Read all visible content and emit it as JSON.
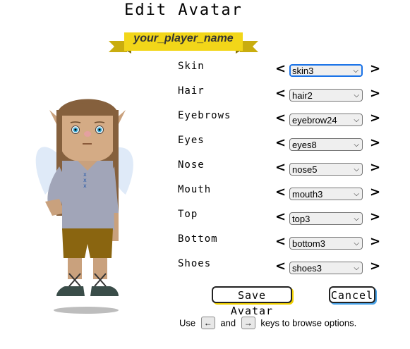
{
  "page": {
    "title": "Edit Avatar"
  },
  "banner": {
    "player_name": "your_player_name"
  },
  "colors": {
    "banner_yellow": "#f2d619",
    "save_accent": "#f0d000",
    "cancel_accent": "#4aa3e8",
    "focus_blue": "#1a73e8"
  },
  "options": [
    {
      "label": "Skin",
      "value": "skin3",
      "prev": "<",
      "next": ">"
    },
    {
      "label": "Hair",
      "value": "hair2",
      "prev": "<",
      "next": ">"
    },
    {
      "label": "Eyebrows",
      "value": "eyebrow24",
      "prev": "<",
      "next": ">"
    },
    {
      "label": "Eyes",
      "value": "eyes8",
      "prev": "<",
      "next": ">"
    },
    {
      "label": "Nose",
      "value": "nose5",
      "prev": "<",
      "next": ">"
    },
    {
      "label": "Mouth",
      "value": "mouth3",
      "prev": "<",
      "next": ">"
    },
    {
      "label": "Top",
      "value": "top3",
      "prev": "<",
      "next": ">"
    },
    {
      "label": "Bottom",
      "value": "bottom3",
      "prev": "<",
      "next": ">"
    },
    {
      "label": "Shoes",
      "value": "shoes3",
      "prev": "<",
      "next": ">"
    }
  ],
  "buttons": {
    "save": "Save Avatar",
    "cancel": "Cancel"
  },
  "hint": {
    "use": "Use",
    "and": "and",
    "rest": "keys to browse options.",
    "left_key": "←",
    "right_key": "→"
  }
}
